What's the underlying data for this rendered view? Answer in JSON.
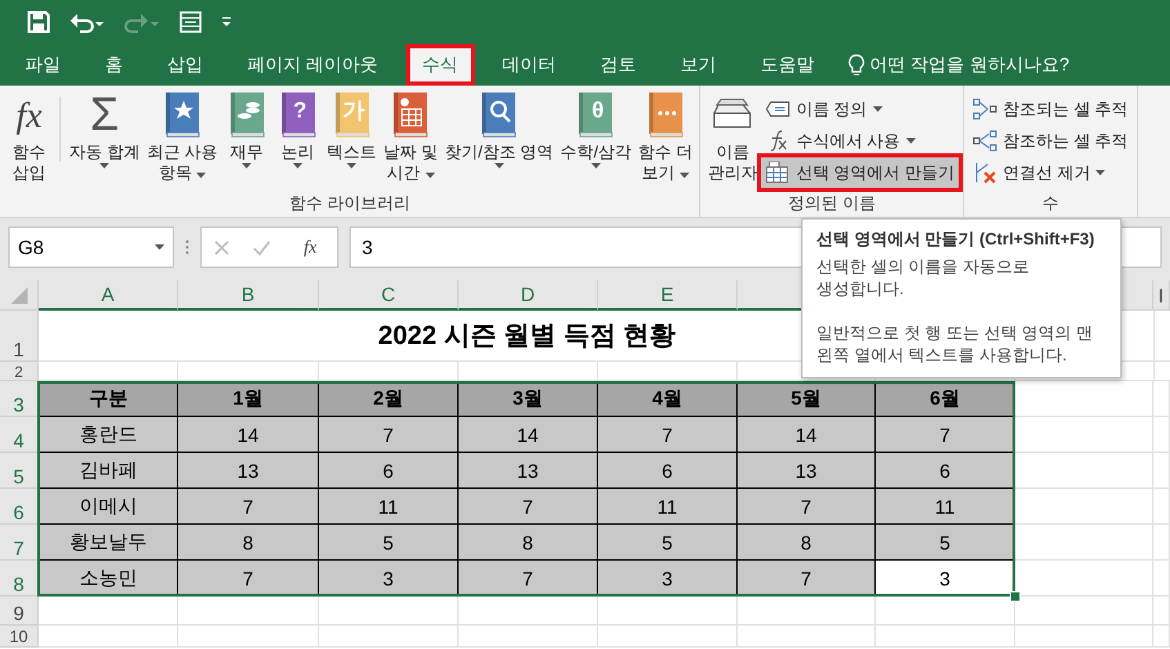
{
  "tabs": [
    {
      "label": "파일",
      "selected": false,
      "highlighted": false
    },
    {
      "label": "홈",
      "selected": false,
      "highlighted": false
    },
    {
      "label": "삽입",
      "selected": false,
      "highlighted": false
    },
    {
      "label": "페이지 레이아웃",
      "selected": false,
      "highlighted": false
    },
    {
      "label": "수식",
      "selected": true,
      "highlighted": true
    },
    {
      "label": "데이터",
      "selected": false,
      "highlighted": false
    },
    {
      "label": "검토",
      "selected": false,
      "highlighted": false
    },
    {
      "label": "보기",
      "selected": false,
      "highlighted": false
    },
    {
      "label": "도움말",
      "selected": false,
      "highlighted": false
    }
  ],
  "tell_me": "어떤 작업을 원하시나요?",
  "ribbon": {
    "groups": [
      {
        "label": "함수 라이브러리",
        "large": [
          {
            "kind": "fx",
            "glyph": "fx",
            "label": "함수\n삽입",
            "dropdown": false
          },
          {
            "kind": "sum",
            "glyph": "Σ",
            "label": "자동 합계",
            "dropdown": true
          },
          {
            "kind": "book",
            "color": "#4a7ebb",
            "label": "최근 사용\n항목",
            "dropdown": true
          },
          {
            "kind": "book",
            "color": "#6aa88e",
            "label": "재무",
            "dropdown": true
          },
          {
            "kind": "book",
            "color": "#8e5fbd",
            "glyph": "?",
            "label": "논리",
            "dropdown": true
          },
          {
            "kind": "book",
            "color": "#f2c46e",
            "glyph": "가",
            "label": "텍스트",
            "dropdown": true
          },
          {
            "kind": "book",
            "color": "#dc5f3c",
            "label": "날짜 및\n시간",
            "dropdown": true
          },
          {
            "kind": "book",
            "color": "#4a7ebb",
            "label": "찾기/참조 영역",
            "dropdown": true
          },
          {
            "kind": "book",
            "color": "#6aa88e",
            "glyph": "θ",
            "label": "수학/삼각",
            "dropdown": true
          },
          {
            "kind": "book",
            "color": "#e8914a",
            "label": "함수 더\n보기",
            "dropdown": true
          }
        ]
      },
      {
        "label": "정의된 이름",
        "large": [
          {
            "kind": "tags",
            "label": "이름\n관리자",
            "dropdown": false
          }
        ],
        "small": [
          {
            "label": "이름 정의",
            "dropdown": true,
            "highlighted": false
          },
          {
            "label": "수식에서 사용",
            "dropdown": true,
            "highlighted": false
          },
          {
            "label": "선택 영역에서 만들기",
            "dropdown": false,
            "highlighted": true
          }
        ]
      },
      {
        "label": "수",
        "small": [
          {
            "label": "참조되는 셀 추적",
            "dropdown": false,
            "highlighted": false
          },
          {
            "label": "참조하는 셀 추적",
            "dropdown": false,
            "highlighted": false
          },
          {
            "label": "연결선 제거",
            "dropdown": true,
            "highlighted": false
          }
        ]
      }
    ]
  },
  "formula_bar": {
    "name_box": "G8",
    "function_glyph": "fx",
    "value": "3"
  },
  "sheet": {
    "column_headers": [
      "A",
      "B",
      "C",
      "D",
      "E"
    ],
    "last_column_header": "I",
    "row_numbers": [
      "1",
      "2",
      "3",
      "4",
      "5",
      "6",
      "7",
      "8",
      "9",
      "10"
    ],
    "title": "2022 시즌 월별 득점 현황",
    "table": {
      "columns": [
        "구분",
        "1월",
        "2월",
        "3월",
        "4월",
        "5월",
        "6월"
      ],
      "rows": [
        {
          "cells": [
            {
              "value": "홍란드",
              "selected": false
            },
            {
              "value": "14",
              "selected": false
            },
            {
              "value": "7",
              "selected": false
            },
            {
              "value": "14",
              "selected": false
            },
            {
              "value": "7",
              "selected": false
            },
            {
              "value": "14",
              "selected": false
            },
            {
              "value": "7",
              "selected": false
            }
          ]
        },
        {
          "cells": [
            {
              "value": "김바페",
              "selected": false
            },
            {
              "value": "13",
              "selected": false
            },
            {
              "value": "6",
              "selected": false
            },
            {
              "value": "13",
              "selected": false
            },
            {
              "value": "6",
              "selected": false
            },
            {
              "value": "13",
              "selected": false
            },
            {
              "value": "6",
              "selected": false
            }
          ]
        },
        {
          "cells": [
            {
              "value": "이메시",
              "selected": false
            },
            {
              "value": "7",
              "selected": false
            },
            {
              "value": "11",
              "selected": false
            },
            {
              "value": "7",
              "selected": false
            },
            {
              "value": "11",
              "selected": false
            },
            {
              "value": "7",
              "selected": false
            },
            {
              "value": "11",
              "selected": false
            }
          ]
        },
        {
          "cells": [
            {
              "value": "황보날두",
              "selected": false
            },
            {
              "value": "8",
              "selected": false
            },
            {
              "value": "5",
              "selected": false
            },
            {
              "value": "8",
              "selected": false
            },
            {
              "value": "5",
              "selected": false
            },
            {
              "value": "8",
              "selected": false
            },
            {
              "value": "5",
              "selected": false
            }
          ]
        },
        {
          "cells": [
            {
              "value": "소농민",
              "selected": false
            },
            {
              "value": "7",
              "selected": false
            },
            {
              "value": "3",
              "selected": false
            },
            {
              "value": "7",
              "selected": false
            },
            {
              "value": "3",
              "selected": false
            },
            {
              "value": "7",
              "selected": false
            },
            {
              "value": "3",
              "selected": true
            }
          ]
        }
      ]
    }
  },
  "tooltip": {
    "title": "선택 영역에서 만들기 (Ctrl+Shift+F3)",
    "paragraphs": [
      "선택한 셀의 이름을 자동으로\n생성합니다.",
      "일반적으로 첫 행 또는 선택 영역의 맨\n왼쪽 열에서 텍스트를 사용합니다."
    ]
  }
}
